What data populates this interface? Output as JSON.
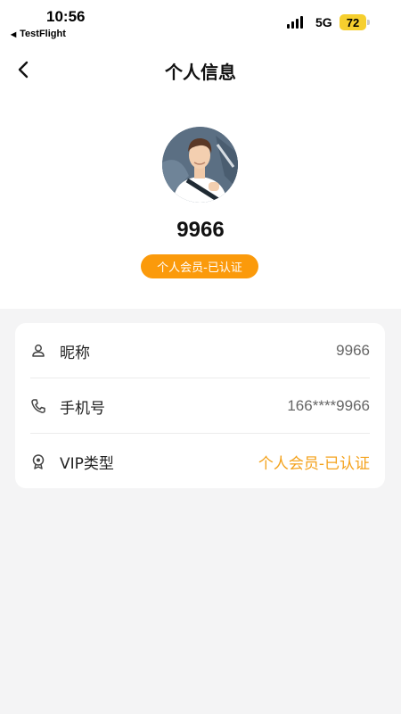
{
  "status_bar": {
    "time": "10:56",
    "back_app": "TestFlight",
    "network": "5G",
    "battery": "72"
  },
  "nav": {
    "title": "个人信息",
    "back_icon": "chevron-left-icon"
  },
  "profile": {
    "nickname": "9966",
    "member_badge": "个人会员-已认证"
  },
  "info_rows": [
    {
      "icon": "user-icon",
      "label": "昵称",
      "value": "9966"
    },
    {
      "icon": "phone-icon",
      "label": "手机号",
      "value": "166****9966"
    },
    {
      "icon": "medal-icon",
      "label": "VIP类型",
      "value": "个人会员-已认证"
    }
  ],
  "colors": {
    "accent": "#fb9a0b",
    "vip_value": "#f4a21c",
    "battery": "#f6cf2e",
    "page_bg": "#f4f4f5"
  }
}
